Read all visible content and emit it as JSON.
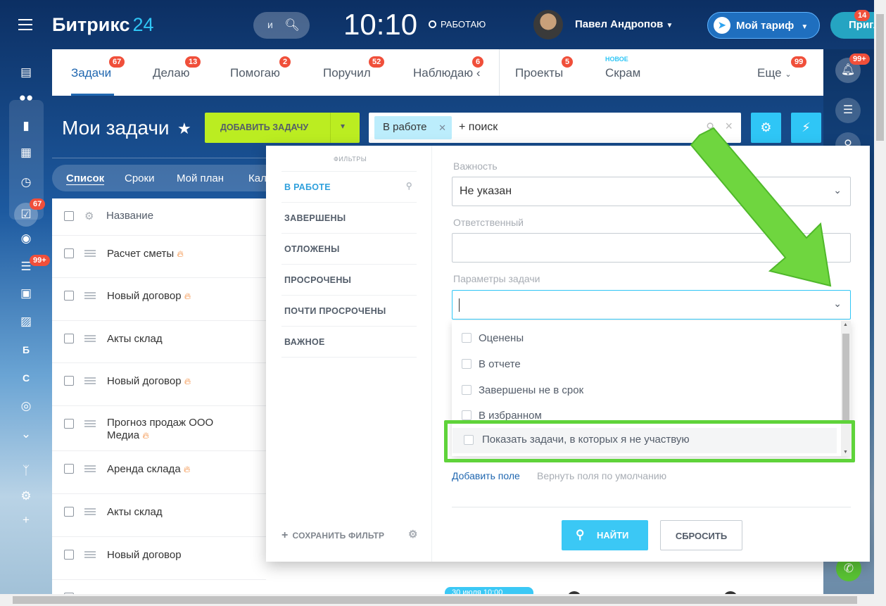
{
  "header": {
    "logo_text": "Битрикс",
    "logo_number": "24",
    "search_placeholder": "и",
    "clock": "10:10",
    "work_status": "РАБОТАЮ",
    "user_name": "Павел Андропов",
    "tariff_label": "Мой тариф",
    "invite_label": "Пригл",
    "invite_badge": "14"
  },
  "leftnav": {
    "tasks_badge": "67",
    "feed_badge": "99+",
    "letter_b": "Б",
    "letter_c": "С"
  },
  "tabs": [
    {
      "label": "Задачи",
      "badge": "67"
    },
    {
      "label": "Делаю",
      "badge": "13"
    },
    {
      "label": "Помогаю",
      "badge": "2"
    },
    {
      "label": "Поручил",
      "badge": "52"
    },
    {
      "label": "Наблюдаю",
      "badge": "6"
    },
    {
      "label": "Проекты",
      "badge": "5"
    },
    {
      "label": "Скрам",
      "tag": "НОВОЕ"
    },
    {
      "label": "Еще",
      "badge": "99"
    }
  ],
  "page": {
    "title": "Мои задачи",
    "add_task_label": "ДОБАВИТЬ ЗАДАЧУ",
    "filter_chip": "В работе",
    "search_plus": "+ поиск"
  },
  "views": [
    "Список",
    "Сроки",
    "Мой план",
    "Кал"
  ],
  "table": {
    "header_name": "Название",
    "rows": [
      {
        "name": "Расчет сметы",
        "hot": true
      },
      {
        "name": "Новый договор",
        "hot": true
      },
      {
        "name": "Акты склад",
        "hot": false
      },
      {
        "name": "Новый договор",
        "hot": true
      },
      {
        "name": "Прогноз продаж ООО Медиа",
        "hot": true
      },
      {
        "name": "Аренда склада",
        "hot": true
      },
      {
        "name": "Акты склад",
        "hot": false
      },
      {
        "name": "Новый договор",
        "hot": false
      }
    ]
  },
  "rightbar": {
    "notif_badge": "99+"
  },
  "filter_popup": {
    "presets_title": "ФИЛЬТРЫ",
    "presets": [
      "В РАБОТЕ",
      "ЗАВЕРШЕНЫ",
      "ОТЛОЖЕНЫ",
      "ПРОСРОЧЕНЫ",
      "ПОЧТИ ПРОСРОЧЕНЫ",
      "ВАЖНОЕ"
    ],
    "save_filter": "СОХРАНИТЬ ФИЛЬТР",
    "importance_label": "Важность",
    "importance_value": "Не указан",
    "responsible_label": "Ответственный",
    "responsible_value": "",
    "params_label": "Параметры задачи",
    "params_value": "",
    "params_options": [
      "Оценены",
      "В отчете",
      "Завершены не в срок",
      "В избранном",
      "Показать задачи, в которых я не участвую"
    ],
    "add_field": "Добавить поле",
    "reset_fields": "Вернуть поля по умолчанию",
    "find_button": "НАЙТИ",
    "reset_button": "СБРОСИТЬ"
  },
  "bottom_partial": {
    "date_pill": "30 июля 10:00"
  },
  "colors": {
    "accent": "#2fc6f6",
    "add_button": "#bbed21",
    "highlight": "#5fd33a",
    "arrow": "#5fd33a",
    "badge": "#f04f3a"
  }
}
